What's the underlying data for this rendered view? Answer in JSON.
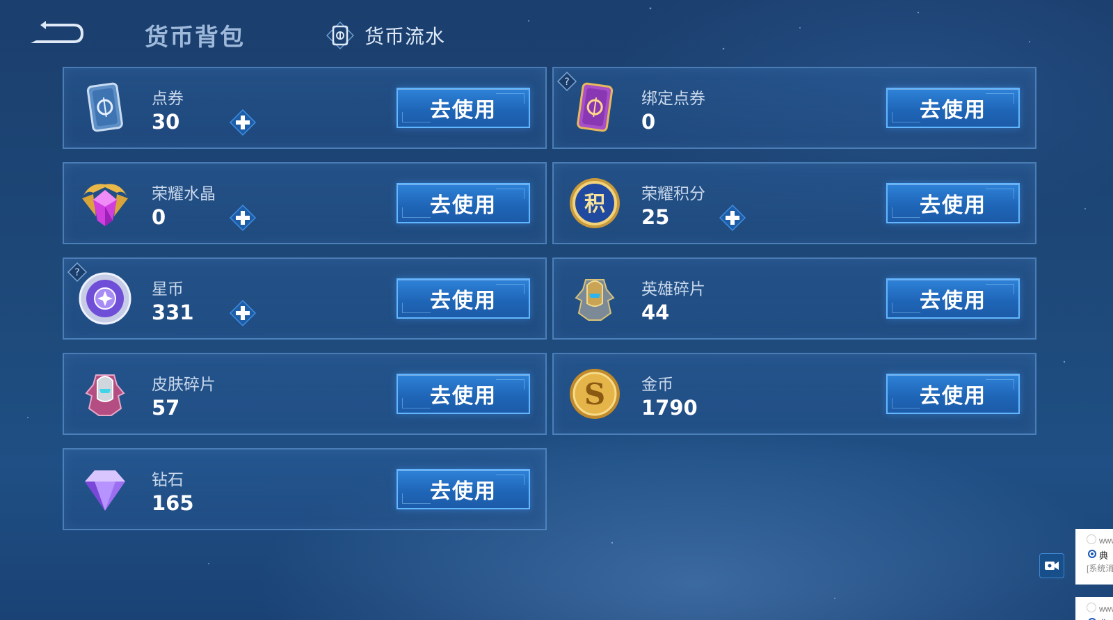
{
  "header": {
    "title": "货币背包",
    "flow_label": "货币流水"
  },
  "currencies": [
    {
      "name": "点券",
      "count": "30",
      "button": "去使用",
      "icon": "blue-voucher-card-icon",
      "has_plus": true,
      "has_help": false
    },
    {
      "name": "绑定点券",
      "count": "0",
      "button": "去使用",
      "icon": "purple-bound-voucher-card-icon",
      "has_plus": false,
      "has_help": true
    },
    {
      "name": "荣耀水晶",
      "count": "0",
      "button": "去使用",
      "icon": "glory-crystal-icon",
      "has_plus": true,
      "has_help": false
    },
    {
      "name": "荣耀积分",
      "count": "25",
      "button": "去使用",
      "icon": "glory-points-coin-icon",
      "has_plus": true,
      "has_help": false
    },
    {
      "name": "星币",
      "count": "331",
      "button": "去使用",
      "icon": "star-coin-icon",
      "has_plus": true,
      "has_help": true
    },
    {
      "name": "英雄碎片",
      "count": "44",
      "button": "去使用",
      "icon": "hero-fragment-icon",
      "has_plus": false,
      "has_help": false
    },
    {
      "name": "皮肤碎片",
      "count": "57",
      "button": "去使用",
      "icon": "skin-fragment-icon",
      "has_plus": false,
      "has_help": false
    },
    {
      "name": "金币",
      "count": "1790",
      "button": "去使用",
      "icon": "gold-coin-icon",
      "has_plus": false,
      "has_help": false
    },
    {
      "name": "钻石",
      "count": "165",
      "button": "去使用",
      "icon": "diamond-icon",
      "has_plus": false,
      "has_help": false
    }
  ],
  "notifications": [
    {
      "line1": "www",
      "line2": "典",
      "line3": "[系统消"
    },
    {
      "line1": "www",
      "line2": "典",
      "line3": ""
    }
  ],
  "colors": {
    "background": "#1d4878",
    "button": "#1f66b8",
    "button_border": "#62b6ff",
    "plus": "#2d8be6"
  }
}
